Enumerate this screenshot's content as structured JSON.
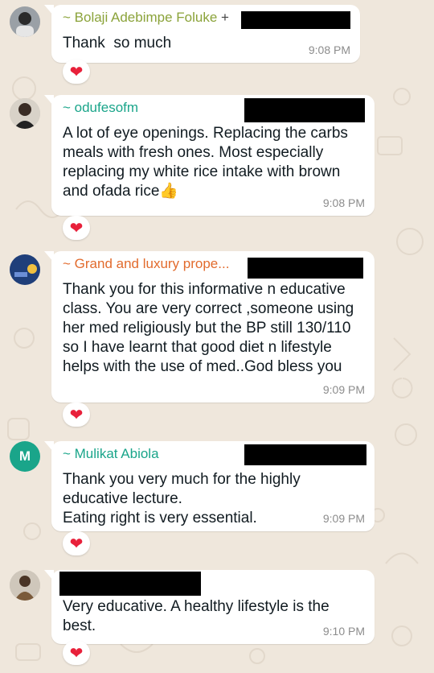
{
  "messages": [
    {
      "sender": "~ Bolaji Adebimpe Foluke",
      "sender_suffix": "+",
      "sender_color": "#8ba33a",
      "text": "Thank  so much",
      "time": "9:08 PM",
      "reaction": "❤"
    },
    {
      "sender": "~ odufesofm",
      "sender_color": "#1aa58a",
      "text": "A lot of eye openings. Replacing the carbs meals with fresh ones. Most especially replacing my white rice intake with brown and ofada rice👍",
      "time": "9:08 PM",
      "reaction": "❤"
    },
    {
      "sender": "~ Grand and luxury prope...",
      "sender_color": "#e26b2d",
      "text": "Thank you for this informative n educative class. You are very correct ,someone using her med religiously but the BP still 130/110  so I have learnt that good diet n lifestyle helps with the use of med..God bless you",
      "time": "9:09 PM",
      "reaction": "❤"
    },
    {
      "sender": "~ Mulikat Abiola",
      "sender_color": "#1aa58a",
      "avatar_letter": "M",
      "text": "Thank you very much for the highly educative lecture.\nEating right is very essential.",
      "time": "9:09 PM",
      "reaction": "❤"
    },
    {
      "text": "Very educative. A healthy lifestyle is the best.",
      "time": "9:10 PM",
      "reaction": "❤"
    }
  ],
  "colors": {
    "background": "#efe7dc",
    "bubble": "#ffffff",
    "time": "#8c8c8c",
    "heart": "#e8203a",
    "avatar_letter_bg": "#1aa58a"
  }
}
